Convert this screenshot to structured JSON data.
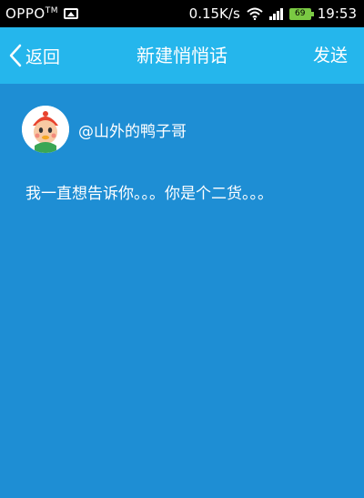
{
  "status_bar": {
    "carrier": "OPPO",
    "carrier_mark": "TM",
    "network_speed": "0.15K/s",
    "battery_level": "69",
    "time": "19:53",
    "icons": [
      "image-icon",
      "wifi-icon",
      "signal-icon",
      "battery-icon"
    ]
  },
  "header": {
    "back_label": "返回",
    "title": "新建悄悄话",
    "send_label": "发送",
    "background_color": "#25b6ec"
  },
  "content": {
    "background_color": "#1e8ed4",
    "mention": "@山外的鸭子哥",
    "message": "我一直想告诉你。。。你是个二货。。。"
  }
}
